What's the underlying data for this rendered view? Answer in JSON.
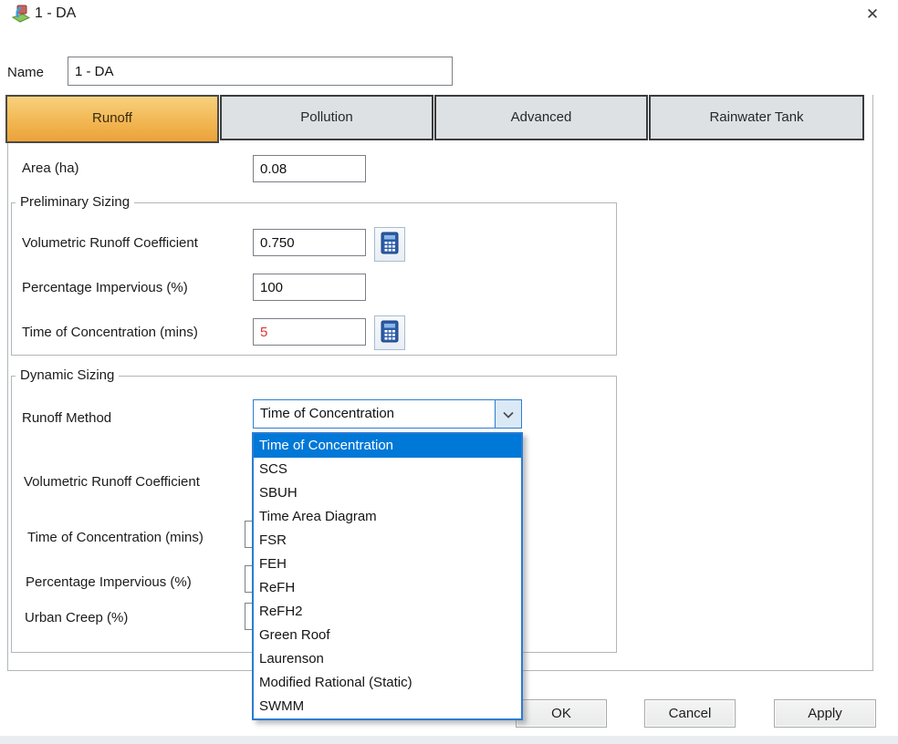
{
  "window": {
    "title": "1 - DA",
    "close_glyph": "✕"
  },
  "name_field": {
    "label": "Name",
    "value": "1 - DA"
  },
  "tabs": [
    {
      "label": "Runoff",
      "selected": true
    },
    {
      "label": "Pollution",
      "selected": false
    },
    {
      "label": "Advanced",
      "selected": false
    },
    {
      "label": "Rainwater Tank",
      "selected": false
    }
  ],
  "area_field": {
    "label": "Area (ha)",
    "value": "0.08"
  },
  "preliminary": {
    "legend": "Preliminary Sizing",
    "rows": [
      {
        "label": "Volumetric Runoff Coefficient",
        "value": "0.750",
        "calculator": true
      },
      {
        "label": "Percentage Impervious (%)",
        "value": "100",
        "calculator": false
      },
      {
        "label": "Time of Concentration (mins)",
        "value": "5",
        "calculator": true,
        "value_state": "error"
      }
    ]
  },
  "dynamic": {
    "legend": "Dynamic Sizing",
    "runoff_method": {
      "label": "Runoff Method",
      "value": "Time of Concentration",
      "selected_index": 0,
      "options": [
        "Time of Concentration",
        "SCS",
        "SBUH",
        "Time Area Diagram",
        "FSR",
        "FEH",
        "ReFH",
        "ReFH2",
        "Green Roof",
        "Laurenson",
        "Modified Rational (Static)",
        "SWMM"
      ]
    },
    "hidden_labels": [
      "Volumetric Runoff Coefficient",
      "Time of Concentration (mins)",
      "Percentage Impervious (%)",
      "Urban Creep (%)"
    ]
  },
  "footer": {
    "ok": "OK",
    "cancel": "Cancel",
    "apply": "Apply"
  },
  "colors": {
    "selected_tab_accent": "#eca23a",
    "list_highlight": "#0078d7",
    "error_text": "#e03333",
    "combo_border": "#2d7ec9"
  }
}
